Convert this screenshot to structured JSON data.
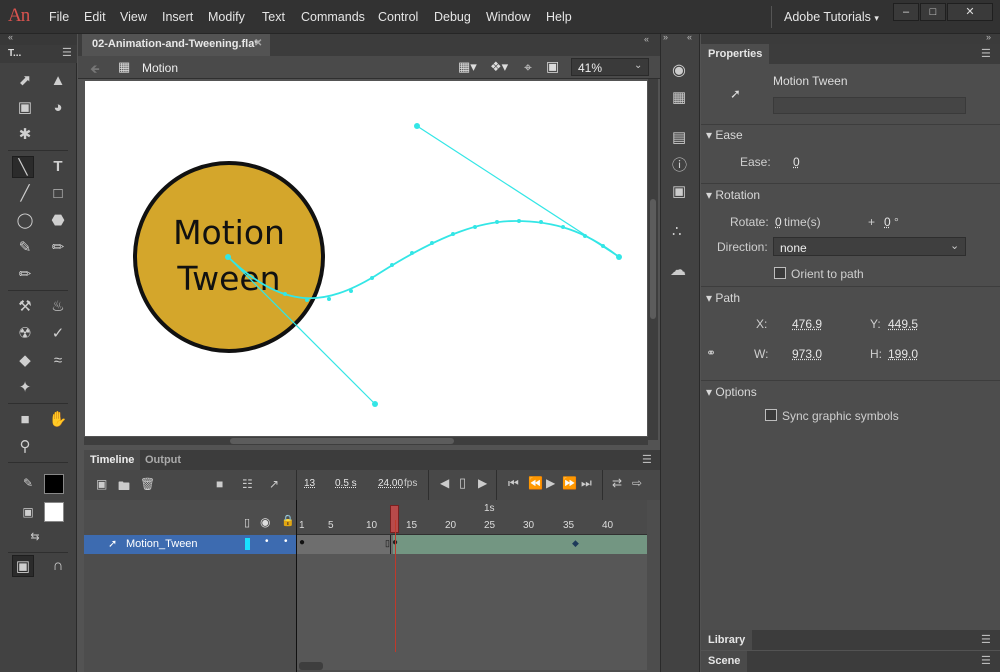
{
  "app": {
    "logo": "An"
  },
  "menu": [
    "File",
    "Edit",
    "View",
    "Insert",
    "Modify",
    "Text",
    "Commands",
    "Control",
    "Debug",
    "Window",
    "Help"
  ],
  "workspace": "Adobe Tutorials",
  "tools_header": "T...",
  "document": {
    "tab": "02-Animation-and-Tweening.fla*",
    "scene": "Motion",
    "zoom": "41%"
  },
  "stage": {
    "text_line1": "Motion",
    "text_line2": "Tween",
    "circle_color": "#d4a62b",
    "path_color": "#33e6e6"
  },
  "timeline": {
    "tabs": [
      "Timeline",
      "Output"
    ],
    "frame": "13",
    "time": "0.5 s",
    "fps": "24.00",
    "fps_unit": "fps",
    "ruler_marks": [
      "1",
      "5",
      "10",
      "15",
      "20",
      "25",
      "30",
      "35",
      "40"
    ],
    "second_mark": "1s",
    "layer_name": "Motion_Tween",
    "playhead_frame": 13
  },
  "properties": {
    "tab": "Properties",
    "object_type": "Motion Tween",
    "instance_name": "",
    "ease": {
      "header": "Ease",
      "label": "Ease:",
      "value": "0"
    },
    "rotation": {
      "header": "Rotation",
      "label": "Rotate:",
      "times": "0",
      "times_unit": "time(s)",
      "plus": "+",
      "degrees": "0",
      "deg_unit": "°",
      "direction_label": "Direction:",
      "direction_value": "none",
      "orient_label": "Orient to path"
    },
    "path": {
      "header": "Path",
      "x_label": "X:",
      "x": "476.9",
      "y_label": "Y:",
      "y": "449.5",
      "w_label": "W:",
      "w": "973.0",
      "h_label": "H:",
      "h": "199.0"
    },
    "options": {
      "header": "Options",
      "sync_label": "Sync graphic symbols"
    }
  },
  "bottom_tabs": {
    "library": "Library",
    "scene": "Scene"
  }
}
